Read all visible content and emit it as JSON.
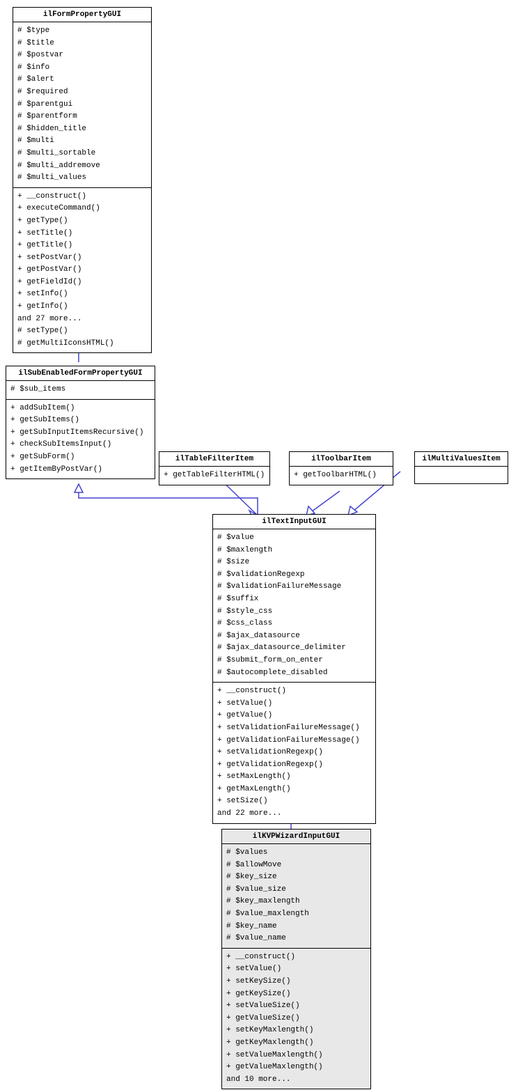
{
  "boxes": {
    "ilFormPropertyGUI": {
      "title": "ilFormPropertyGUI",
      "attributes": [
        "# $type",
        "# $title",
        "# $postvar",
        "# $info",
        "# $alert",
        "# $required",
        "# $parentgui",
        "# $parentform",
        "# $hidden_title",
        "# $multi",
        "# $multi_sortable",
        "# $multi_addremove",
        "# $multi_values"
      ],
      "methods": [
        "+ __construct()",
        "+ executeCommand()",
        "+ getType()",
        "+ setTitle()",
        "+ getTitle()",
        "+ setPostVar()",
        "+ getPostVar()",
        "+ getFieldId()",
        "+ setInfo()",
        "+ getInfo()",
        "and 27 more...",
        "# setType()",
        "# getMultiIconsHTML()"
      ]
    },
    "ilSubEnabledFormPropertyGUI": {
      "title": "ilSubEnabledFormPropertyGUI",
      "attributes": [
        "# $sub_items"
      ],
      "methods": [
        "+ addSubItem()",
        "+ getSubItems()",
        "+ getSubInputItemsRecursive()",
        "+ checkSubItemsInput()",
        "+ getSubForm()",
        "+ getItemByPostVar()"
      ]
    },
    "ilTableFilterItem": {
      "title": "ilTableFilterItem",
      "attributes": [],
      "methods": [
        "+ getTableFilterHTML()"
      ]
    },
    "ilToolbarItem": {
      "title": "ilToolbarItem",
      "attributes": [],
      "methods": [
        "+ getToolbarHTML()"
      ]
    },
    "ilMultiValuesItem": {
      "title": "ilMultiValuesItem",
      "attributes": [],
      "methods": []
    },
    "ilTextInputGUI": {
      "title": "ilTextInputGUI",
      "attributes": [
        "# $value",
        "# $maxlength",
        "# $size",
        "# $validationRegexp",
        "# $validationFailureMessage",
        "# $suffix",
        "# $style_css",
        "# $css_class",
        "# $ajax_datasource",
        "# $ajax_datasource_delimiter",
        "# $submit_form_on_enter",
        "# $autocomplete_disabled"
      ],
      "methods": [
        "+ __construct()",
        "+ setValue()",
        "+ getValue()",
        "+ setValidationFailureMessage()",
        "+ getValidationFailureMessage()",
        "+ setValidationRegexp()",
        "+ getValidationRegexp()",
        "+ setMaxLength()",
        "+ getMaxLength()",
        "+ setSize()",
        "and 22 more..."
      ]
    },
    "ilKVPWizardInputGUI": {
      "title": "ilKVPWizardInputGUI",
      "attributes": [
        "# $values",
        "# $allowMove",
        "# $key_size",
        "# $value_size",
        "# $key_maxlength",
        "# $value_maxlength",
        "# $key_name",
        "# $value_name"
      ],
      "methods": [
        "+ __construct()",
        "+ setValue()",
        "+ setKeySize()",
        "+ getKeySize()",
        "+ setValueSize()",
        "+ getValueSize()",
        "+ setKeyMaxlength()",
        "+ getKeyMaxlength()",
        "+ setValueMaxlength()",
        "+ getValueMaxlength()",
        "and 10 more..."
      ]
    }
  }
}
